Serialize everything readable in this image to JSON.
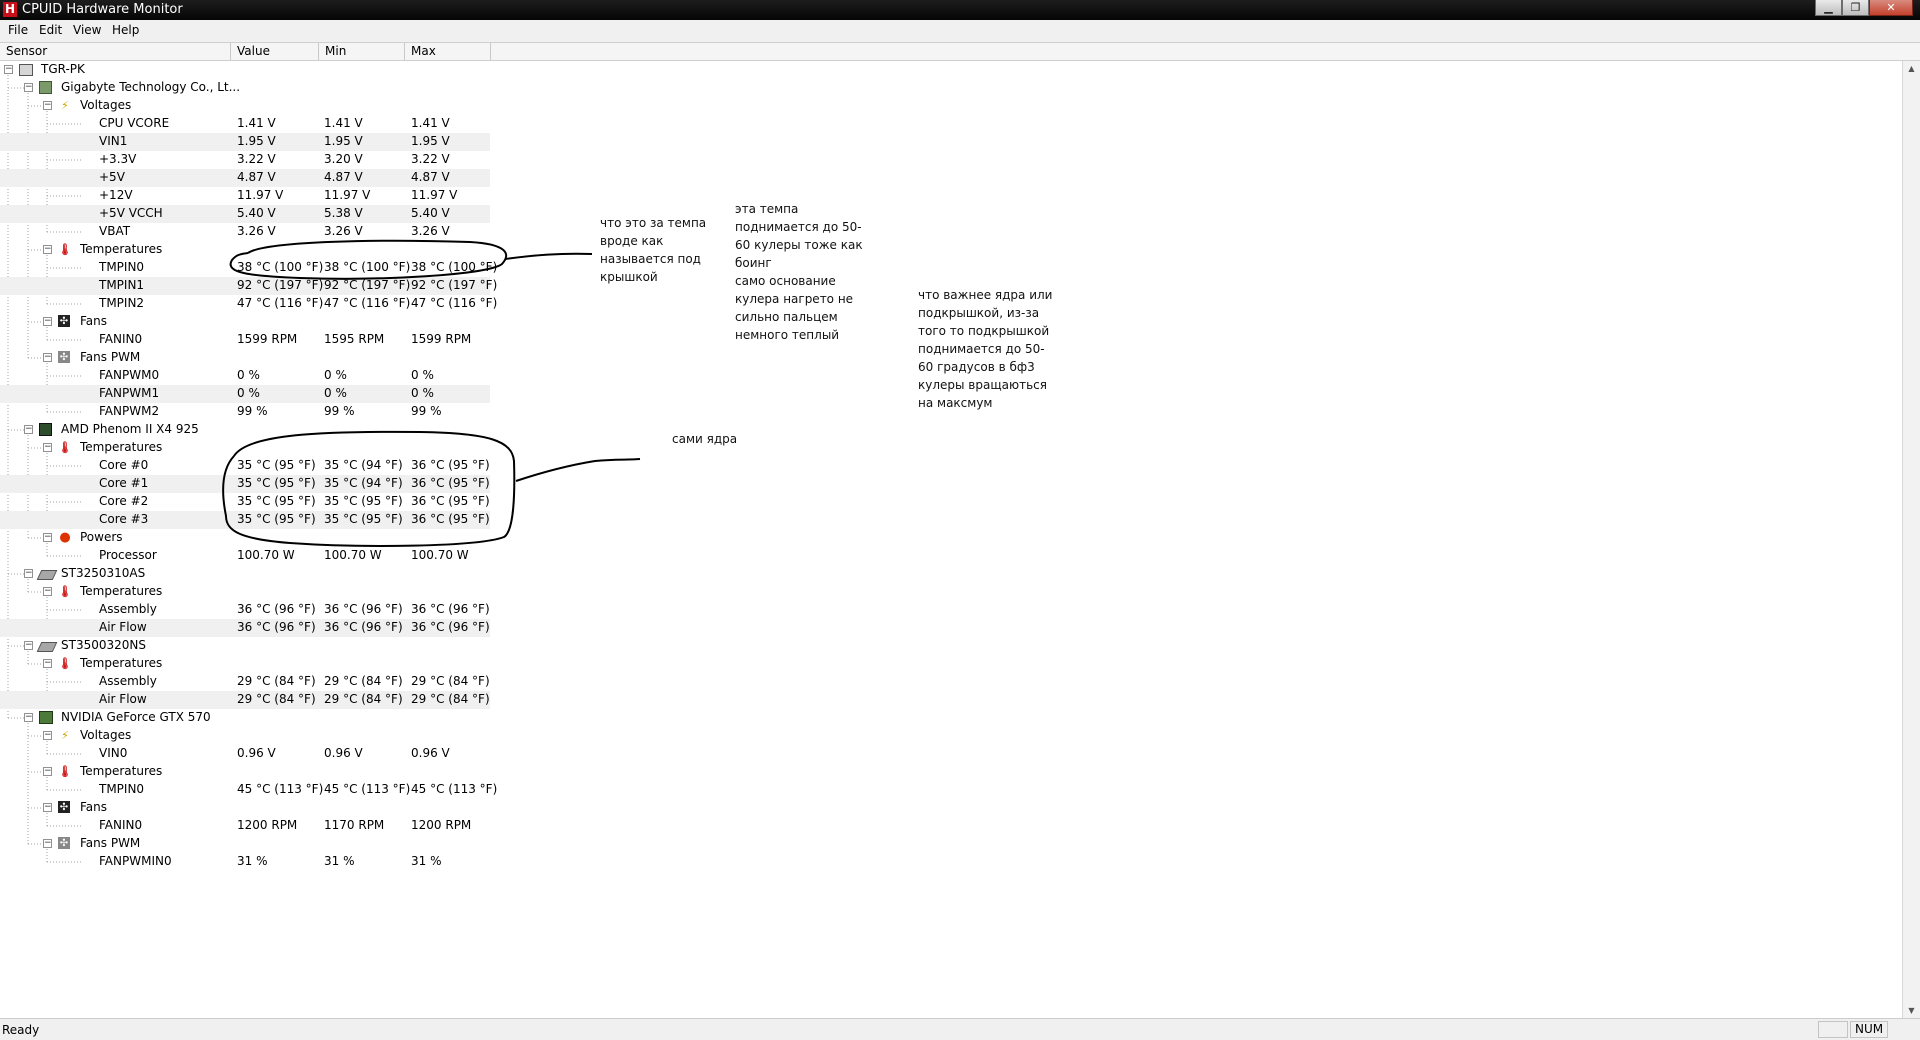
{
  "window": {
    "title": "CPUID Hardware Monitor",
    "icon_letter": "H"
  },
  "menu": [
    "File",
    "Edit",
    "View",
    "Help"
  ],
  "columns": [
    "Sensor",
    "Value",
    "Min",
    "Max"
  ],
  "tree": [
    {
      "level": 0,
      "icon": "computer-icon",
      "label": "TGR-PK",
      "toggle": "-"
    },
    {
      "level": 1,
      "icon": "motherboard-icon",
      "label": "Gigabyte Technology Co., Lt...",
      "toggle": "-"
    },
    {
      "level": 2,
      "icon": "voltage-icon",
      "label": "Voltages",
      "toggle": "-"
    },
    {
      "level": 3,
      "label": "CPU VCORE",
      "value": "1.41 V",
      "min": "1.41 V",
      "max": "1.41 V"
    },
    {
      "level": 3,
      "label": "VIN1",
      "value": "1.95 V",
      "min": "1.95 V",
      "max": "1.95 V"
    },
    {
      "level": 3,
      "label": "+3.3V",
      "value": "3.22 V",
      "min": "3.20 V",
      "max": "3.22 V"
    },
    {
      "level": 3,
      "label": "+5V",
      "value": "4.87 V",
      "min": "4.87 V",
      "max": "4.87 V"
    },
    {
      "level": 3,
      "label": "+12V",
      "value": "11.97 V",
      "min": "11.97 V",
      "max": "11.97 V"
    },
    {
      "level": 3,
      "label": "+5V VCCH",
      "value": "5.40 V",
      "min": "5.38 V",
      "max": "5.40 V"
    },
    {
      "level": 3,
      "label": "VBAT",
      "value": "3.26 V",
      "min": "3.26 V",
      "max": "3.26 V"
    },
    {
      "level": 2,
      "icon": "thermometer-icon",
      "label": "Temperatures",
      "toggle": "-"
    },
    {
      "level": 3,
      "label": "TMPIN0",
      "value": "38 °C  (100 °F)",
      "min": "38 °C  (100 °F)",
      "max": "38 °C  (100 °F)"
    },
    {
      "level": 3,
      "label": "TMPIN1",
      "value": "92 °C  (197 °F)",
      "min": "92 °C  (197 °F)",
      "max": "92 °C  (197 °F)"
    },
    {
      "level": 3,
      "label": "TMPIN2",
      "value": "47 °C  (116 °F)",
      "min": "47 °C  (116 °F)",
      "max": "47 °C  (116 °F)"
    },
    {
      "level": 2,
      "icon": "fan-icon",
      "label": "Fans",
      "toggle": "-"
    },
    {
      "level": 3,
      "label": "FANIN0",
      "value": "1599 RPM",
      "min": "1595 RPM",
      "max": "1599 RPM"
    },
    {
      "level": 2,
      "icon": "fan-pwm-icon",
      "label": "Fans PWM",
      "toggle": "-"
    },
    {
      "level": 3,
      "label": "FANPWM0",
      "value": "0 %",
      "min": "0 %",
      "max": "0 %"
    },
    {
      "level": 3,
      "label": "FANPWM1",
      "value": "0 %",
      "min": "0 %",
      "max": "0 %"
    },
    {
      "level": 3,
      "label": "FANPWM2",
      "value": "99 %",
      "min": "99 %",
      "max": "99 %"
    },
    {
      "level": 1,
      "icon": "cpu-icon",
      "label": "AMD Phenom II X4 925",
      "toggle": "-"
    },
    {
      "level": 2,
      "icon": "thermometer-icon",
      "label": "Temperatures",
      "toggle": "-"
    },
    {
      "level": 3,
      "label": "Core #0",
      "value": "35 °C  (95 °F)",
      "min": "35 °C  (94 °F)",
      "max": "36 °C  (95 °F)"
    },
    {
      "level": 3,
      "label": "Core #1",
      "value": "35 °C  (95 °F)",
      "min": "35 °C  (94 °F)",
      "max": "36 °C  (95 °F)"
    },
    {
      "level": 3,
      "label": "Core #2",
      "value": "35 °C  (95 °F)",
      "min": "35 °C  (95 °F)",
      "max": "36 °C  (95 °F)"
    },
    {
      "level": 3,
      "label": "Core #3",
      "value": "35 °C  (95 °F)",
      "min": "35 °C  (95 °F)",
      "max": "36 °C  (95 °F)"
    },
    {
      "level": 2,
      "icon": "power-icon",
      "label": "Powers",
      "toggle": "-"
    },
    {
      "level": 3,
      "label": "Processor",
      "value": "100.70 W",
      "min": "100.70 W",
      "max": "100.70 W"
    },
    {
      "level": 1,
      "icon": "hard-drive-icon",
      "label": "ST3250310AS",
      "toggle": "-"
    },
    {
      "level": 2,
      "icon": "thermometer-icon",
      "label": "Temperatures",
      "toggle": "-"
    },
    {
      "level": 3,
      "label": "Assembly",
      "value": "36 °C  (96 °F)",
      "min": "36 °C  (96 °F)",
      "max": "36 °C  (96 °F)"
    },
    {
      "level": 3,
      "label": "Air Flow",
      "value": "36 °C  (96 °F)",
      "min": "36 °C  (96 °F)",
      "max": "36 °C  (96 °F)"
    },
    {
      "level": 1,
      "icon": "hard-drive-icon",
      "label": "ST3500320NS",
      "toggle": "-"
    },
    {
      "level": 2,
      "icon": "thermometer-icon",
      "label": "Temperatures",
      "toggle": "-"
    },
    {
      "level": 3,
      "label": "Assembly",
      "value": "29 °C  (84 °F)",
      "min": "29 °C  (84 °F)",
      "max": "29 °C  (84 °F)"
    },
    {
      "level": 3,
      "label": "Air Flow",
      "value": "29 °C  (84 °F)",
      "min": "29 °C  (84 °F)",
      "max": "29 °C  (84 °F)"
    },
    {
      "level": 1,
      "icon": "graphics-card-icon",
      "label": "NVIDIA GeForce GTX 570",
      "toggle": "-"
    },
    {
      "level": 2,
      "icon": "voltage-icon",
      "label": "Voltages",
      "toggle": "-"
    },
    {
      "level": 3,
      "label": "VIN0",
      "value": "0.96 V",
      "min": "0.96 V",
      "max": "0.96 V"
    },
    {
      "level": 2,
      "icon": "thermometer-icon",
      "label": "Temperatures",
      "toggle": "-"
    },
    {
      "level": 3,
      "label": "TMPIN0",
      "value": "45 °C  (113 °F)",
      "min": "45 °C  (113 °F)",
      "max": "45 °C  (113 °F)"
    },
    {
      "level": 2,
      "icon": "fan-icon",
      "label": "Fans",
      "toggle": "-"
    },
    {
      "level": 3,
      "label": "FANIN0",
      "value": "1200 RPM",
      "min": "1170 RPM",
      "max": "1200 RPM"
    },
    {
      "level": 2,
      "icon": "fan-pwm-icon",
      "label": "Fans PWM",
      "toggle": "-"
    },
    {
      "level": 3,
      "label": "FANPWMIN0",
      "value": "31 %",
      "min": "31 %",
      "max": "31 %"
    }
  ],
  "annotations": {
    "note1": "что это за темпа\nвроде как\nназывается под\nкрышкой",
    "note2": "эта темпа\nподнимается до 50-\n60 кулеры тоже как\nбоинг\nсамо основание\nкулера нагрето не\nсильно пальцем\nнемного теплый",
    "note3": "что важнее ядра или\nподкрышкой, из-за\nтого то подкрышкой\nподнимается до 50-\n60 градусов в бф3\nкулеры вращаються\nна максмум",
    "note4": "сами ядра"
  },
  "status": {
    "text": "Ready",
    "num": "NUM"
  }
}
